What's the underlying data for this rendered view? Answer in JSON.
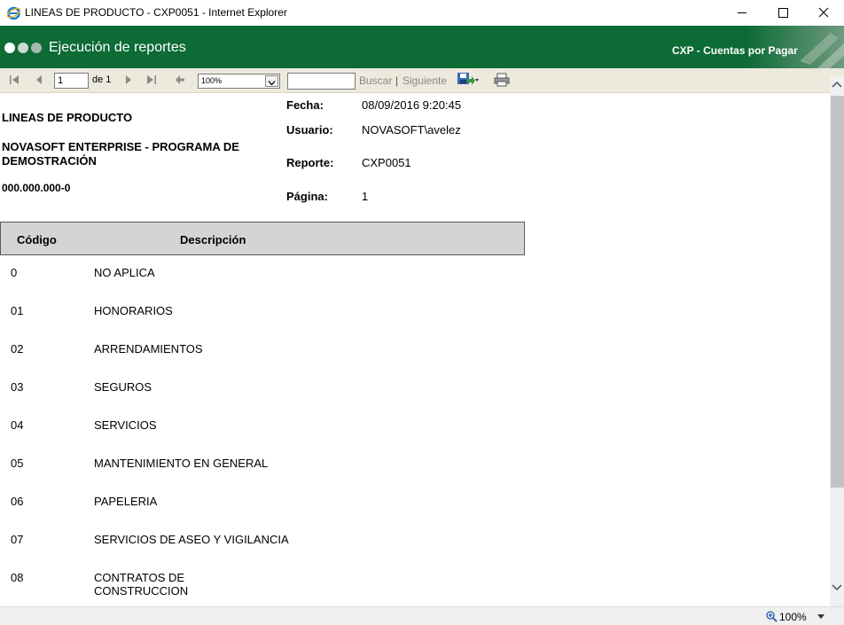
{
  "window": {
    "title": "LINEAS DE PRODUCTO - CXP0051 - Internet Explorer"
  },
  "header": {
    "title": "Ejecución de reportes",
    "module": "CXP - Cuentas por Pagar"
  },
  "toolbar": {
    "page_current": "1",
    "page_of": "de 1",
    "zoom": "100%",
    "search_value": "",
    "find_label": "Buscar",
    "separator": "|",
    "next_label": "Siguiente"
  },
  "report": {
    "title": "LINEAS DE PRODUCTO",
    "company": "NOVASOFT ENTERPRISE - PROGRAMA DE\nDEMOSTRACIÓN",
    "company_line1": "NOVASOFT ENTERPRISE - PROGRAMA DE",
    "company_line2": "DEMOSTRACIÓN",
    "nit": "000.000.000-0",
    "fecha_label": "Fecha:",
    "fecha_value": "08/09/2016 9:20:45",
    "usuario_label": "Usuario:",
    "usuario_value": "NOVASOFT\\avelez",
    "reporte_label": "Reporte:",
    "reporte_value": "CXP0051",
    "pagina_label": "Página:",
    "pagina_value": "1",
    "columns": {
      "code": "Código",
      "description": "Descripción"
    },
    "rows": [
      {
        "code": "0",
        "description": "NO APLICA"
      },
      {
        "code": "01",
        "description": "HONORARIOS"
      },
      {
        "code": "02",
        "description": "ARRENDAMIENTOS"
      },
      {
        "code": "03",
        "description": "SEGUROS"
      },
      {
        "code": "04",
        "description": "SERVICIOS"
      },
      {
        "code": "05",
        "description": "MANTENIMIENTO EN GENERAL"
      },
      {
        "code": "06",
        "description": "PAPELERIA"
      },
      {
        "code": "07",
        "description": "SERVICIOS DE ASEO Y VIGILANCIA"
      },
      {
        "code": "08",
        "description_line1": "CONTRATOS DE",
        "description_line2": "CONSTRUCCION"
      }
    ]
  },
  "statusbar": {
    "zoom": "100%"
  },
  "colors": {
    "header_green": "#0d6b36",
    "toolbar_bg": "#ede9dc",
    "table_header_bg": "#d4d4d4"
  },
  "icons": {
    "app": "internet-explorer-icon",
    "first_page": "first-page-icon",
    "prev_page": "previous-page-icon",
    "next_page": "next-page-icon",
    "last_page": "last-page-icon",
    "back": "back-to-parent-icon",
    "export": "export-save-icon",
    "print": "print-icon",
    "zoom": "magnifier-zoom-icon"
  }
}
